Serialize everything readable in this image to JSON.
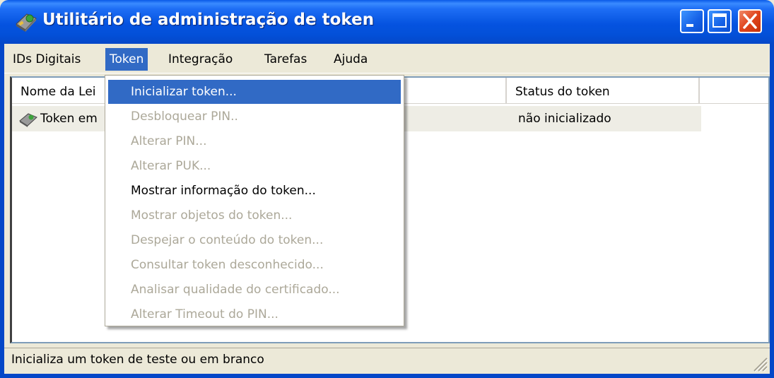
{
  "window": {
    "title": "Utilitário de administração de token"
  },
  "menubar": {
    "items": [
      {
        "label": "IDs Digitais"
      },
      {
        "label": "Token"
      },
      {
        "label": "Integração"
      },
      {
        "label": "Tarefas"
      },
      {
        "label": "Ajuda"
      }
    ]
  },
  "list": {
    "columns": [
      {
        "label": "Nome da Lei"
      },
      {
        "label": "Status do token"
      }
    ],
    "rows": [
      {
        "name": "Token em",
        "status": "não inicializado"
      }
    ]
  },
  "token_menu": {
    "items": [
      {
        "label": "Inicializar token...",
        "enabled": true,
        "highlighted": true
      },
      {
        "label": "Desbloquear PIN..",
        "enabled": false
      },
      {
        "label": "Alterar PIN...",
        "enabled": false
      },
      {
        "label": "Alterar PUK...",
        "enabled": false
      },
      {
        "label": "Mostrar informação do token...",
        "enabled": true
      },
      {
        "label": "Mostrar objetos do token...",
        "enabled": false
      },
      {
        "label": "Despejar o conteúdo do token...",
        "enabled": false
      },
      {
        "label": "Consultar token desconhecido...",
        "enabled": false
      },
      {
        "label": "Analisar qualidade do certificado...",
        "enabled": false
      },
      {
        "label": "Alterar Timeout do PIN...",
        "enabled": false
      }
    ]
  },
  "statusbar": {
    "text": "Inicializa um token de teste ou em branco"
  },
  "colors": {
    "titlebar": "#0553E0",
    "menu_highlight": "#316AC5",
    "disabled_text": "#ACA899",
    "close_button": "#E0441C"
  },
  "icons": {
    "app": "token-device-icon",
    "row": "token-device-icon",
    "minimize": "minimize-icon",
    "maximize": "maximize-icon",
    "close": "close-icon",
    "grip": "resize-grip-icon"
  }
}
